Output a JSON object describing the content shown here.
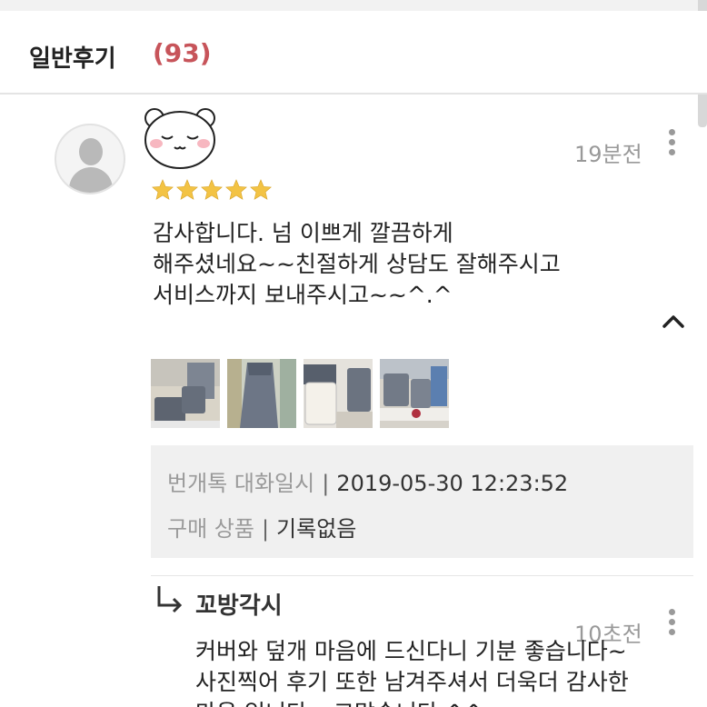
{
  "section": {
    "title": "일반후기",
    "count": "(93)"
  },
  "review": {
    "avatar_icon": "default-user-avatar",
    "emoticon": "blushing-bear-emoticon",
    "time": "19분전",
    "rating": 5,
    "rating_max": 5,
    "star_color": "#f3c344",
    "lines": [
      "감사합니다. 넘 이쁘게 깔끔하게",
      "해주셨네요~~친절하게 상담도 잘해주시고",
      "서비스까지 보내주시고~~^.^"
    ],
    "photos": [
      "photo-1",
      "photo-2",
      "photo-3",
      "photo-4"
    ],
    "info": {
      "chat_label": "번개톡 대화일시",
      "chat_value": "2019-05-30 12:23:52",
      "product_label": "구매 상품",
      "product_value": "기록없음"
    }
  },
  "reply": {
    "author": "꼬방각시",
    "time": "10초전",
    "lines": [
      "커버와 덮개 마음에 드신다니 기분 좋습니다~",
      "사진찍어 후기 또한 남겨주셔서 더욱더 감사한",
      "마음 입니다~ 고맙습니다 ^^"
    ]
  },
  "colors": {
    "count_accent": "#c7545a",
    "muted_text": "#999999",
    "info_bg": "#f0f0f0"
  }
}
